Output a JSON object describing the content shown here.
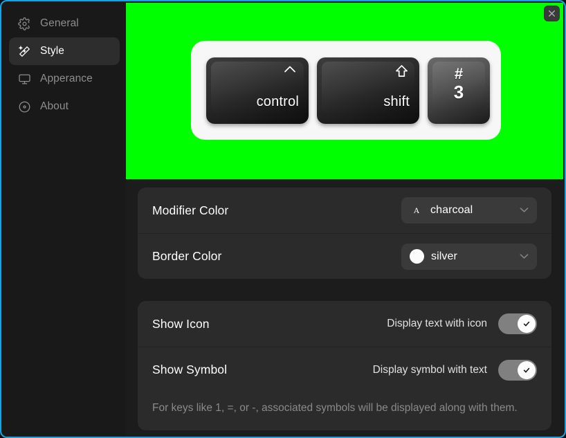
{
  "window": {
    "accent_border_color": "#1aa3e0",
    "background": "#1c1c1c"
  },
  "sidebar": {
    "items": [
      {
        "label": "General",
        "icon": "gear-icon",
        "active": false
      },
      {
        "label": "Style",
        "icon": "magic-wand-icon",
        "active": true
      },
      {
        "label": "Apperance",
        "icon": "monitor-icon",
        "active": false
      },
      {
        "label": "About",
        "icon": "info-disc-icon",
        "active": false
      }
    ]
  },
  "preview": {
    "background_color": "#00ff00",
    "close_label": "×",
    "tray_background": "#f7f7f7",
    "keys": [
      {
        "name": "control",
        "label": "control",
        "symbol": "^",
        "style": "dark",
        "width": "wide",
        "layout": "corner"
      },
      {
        "name": "shift",
        "label": "shift",
        "symbol": "⇧",
        "style": "dark",
        "width": "wide",
        "layout": "corner"
      },
      {
        "name": "three",
        "label": "3",
        "symbol": "#",
        "style": "light",
        "width": "square",
        "layout": "stacked"
      }
    ]
  },
  "settings": {
    "color_card": [
      {
        "title": "Modifier Color",
        "control": "dropdown",
        "swatch_type": "letter",
        "swatch_letter": "A",
        "value": "charcoal"
      },
      {
        "title": "Border Color",
        "control": "dropdown",
        "swatch_type": "circle",
        "swatch_color": "#fbfbfb",
        "value": "silver"
      }
    ],
    "toggle_card": [
      {
        "title": "Show Icon",
        "subtitle": "Display text with icon",
        "control": "toggle",
        "checked": true
      },
      {
        "title": "Show Symbol",
        "subtitle": "Display symbol with text",
        "control": "toggle",
        "checked": true
      }
    ],
    "note": "For keys like 1, =, or -, associated symbols will be displayed along with them."
  }
}
